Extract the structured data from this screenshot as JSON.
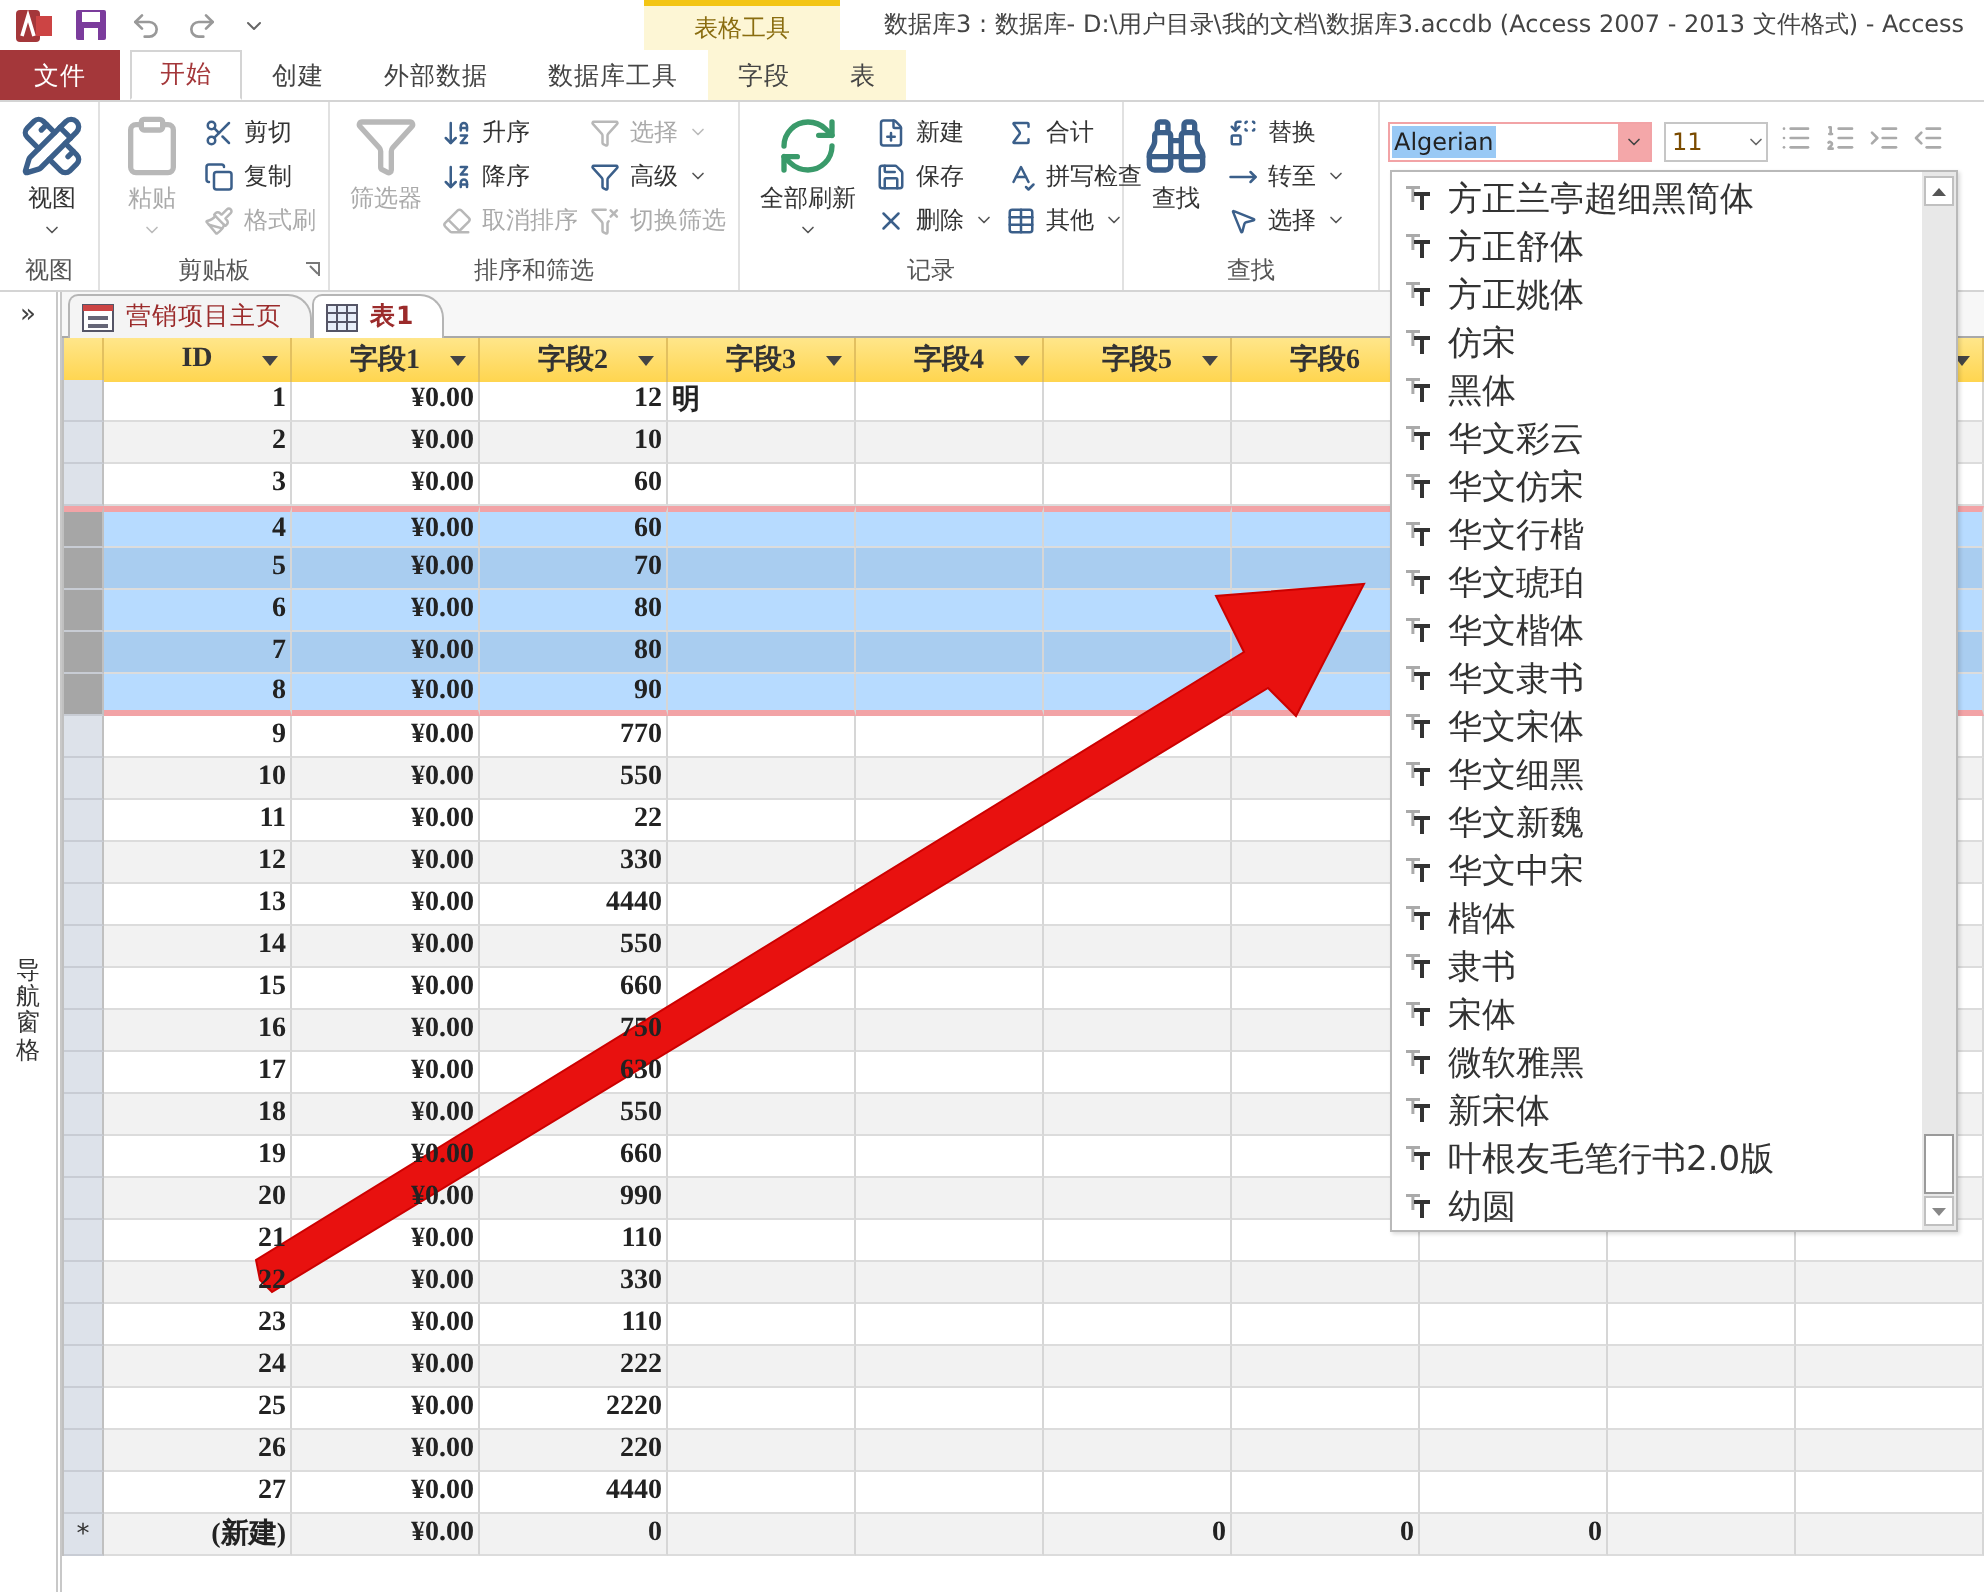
{
  "window": {
    "title": "数据库3 : 数据库- D:\\用户目录\\我的文档\\数据库3.accdb (Access 2007 - 2013 文件格式) - Access",
    "context_label": "表格工具"
  },
  "tabs": [
    {
      "label": "文件",
      "kind": "file",
      "selected": false
    },
    {
      "label": "开始",
      "kind": "normal",
      "selected": true
    },
    {
      "label": "创建",
      "kind": "normal",
      "selected": false
    },
    {
      "label": "外部数据",
      "kind": "normal",
      "selected": false
    },
    {
      "label": "数据库工具",
      "kind": "normal",
      "selected": false
    },
    {
      "label": "字段",
      "kind": "context",
      "selected": false
    },
    {
      "label": "表",
      "kind": "context",
      "selected": false
    }
  ],
  "ribbon": [
    {
      "label": "视图",
      "items": [
        {
          "label": "视图",
          "kind": "large",
          "disabled": false,
          "dropdown": true
        }
      ]
    },
    {
      "label": "剪贴板",
      "launcher": true,
      "items": [
        {
          "label": "粘贴",
          "kind": "large",
          "disabled": true,
          "dropdown": true
        },
        {
          "label": "剪切",
          "kind": "small",
          "disabled": false,
          "dropdown": false
        },
        {
          "label": "复制",
          "kind": "small",
          "disabled": false,
          "dropdown": false
        },
        {
          "label": "格式刷",
          "kind": "small",
          "disabled": true,
          "dropdown": false
        }
      ]
    },
    {
      "label": "排序和筛选",
      "items": [
        {
          "label": "筛选器",
          "kind": "large",
          "disabled": true,
          "dropdown": false
        },
        {
          "label": "升序",
          "kind": "small",
          "disabled": false,
          "dropdown": false
        },
        {
          "label": "降序",
          "kind": "small",
          "disabled": false,
          "dropdown": false
        },
        {
          "label": "取消排序",
          "kind": "small",
          "disabled": true,
          "dropdown": false
        },
        {
          "label": "选择",
          "kind": "small",
          "disabled": true,
          "dropdown": true
        },
        {
          "label": "高级",
          "kind": "small",
          "disabled": false,
          "dropdown": true
        },
        {
          "label": "切换筛选",
          "kind": "small",
          "disabled": true,
          "dropdown": false
        }
      ]
    },
    {
      "label": "记录",
      "items": [
        {
          "label": "全部刷新",
          "kind": "large",
          "disabled": false,
          "dropdown": true
        },
        {
          "label": "新建",
          "kind": "small",
          "disabled": false,
          "dropdown": false
        },
        {
          "label": "保存",
          "kind": "small",
          "disabled": false,
          "dropdown": false
        },
        {
          "label": "删除",
          "kind": "small",
          "disabled": false,
          "dropdown": true
        },
        {
          "label": "合计",
          "kind": "small",
          "disabled": false,
          "dropdown": false
        },
        {
          "label": "拼写检查",
          "kind": "small",
          "disabled": false,
          "dropdown": false
        },
        {
          "label": "其他",
          "kind": "small",
          "disabled": false,
          "dropdown": true
        }
      ]
    },
    {
      "label": "查找",
      "items": [
        {
          "label": "查找",
          "kind": "large",
          "disabled": false,
          "dropdown": false
        },
        {
          "label": "替换",
          "kind": "small",
          "disabled": false,
          "dropdown": false
        },
        {
          "label": "转至",
          "kind": "small",
          "disabled": false,
          "dropdown": true
        },
        {
          "label": "选择",
          "kind": "small",
          "disabled": false,
          "dropdown": true
        }
      ]
    }
  ],
  "font_box": {
    "value": "Algerian",
    "size": "11"
  },
  "font_list": [
    "方正兰亭超细黑简体",
    "方正舒体",
    "方正姚体",
    "仿宋",
    "黑体",
    "华文彩云",
    "华文仿宋",
    "华文行楷",
    "华文琥珀",
    "华文楷体",
    "华文隶书",
    "华文宋体",
    "华文细黑",
    "华文新魏",
    "华文中宋",
    "楷体",
    "隶书",
    "宋体",
    "微软雅黑",
    "新宋体",
    "叶根友毛笔行书2.0版",
    "幼圆"
  ],
  "nav_pane": {
    "label": "导航窗格",
    "toggle": "»"
  },
  "doc_tabs": [
    {
      "label": "营销项目主页",
      "kind": "form",
      "selected": false
    },
    {
      "label": "表1",
      "kind": "table",
      "selected": true
    }
  ],
  "table": {
    "columns": [
      "ID",
      "字段1",
      "字段2",
      "字段3",
      "字段4",
      "字段5",
      "字段6"
    ],
    "rows": [
      {
        "selected": false,
        "id": "1",
        "field_1": "¥0.00",
        "field_2": "12",
        "field_3": "明"
      },
      {
        "selected": false,
        "id": "2",
        "field_1": "¥0.00",
        "field_2": "10"
      },
      {
        "selected": false,
        "id": "3",
        "field_1": "¥0.00",
        "field_2": "60"
      },
      {
        "selected": true,
        "id": "4",
        "field_1": "¥0.00",
        "field_2": "60"
      },
      {
        "selected": true,
        "id": "5",
        "field_1": "¥0.00",
        "field_2": "70"
      },
      {
        "selected": true,
        "id": "6",
        "field_1": "¥0.00",
        "field_2": "80"
      },
      {
        "selected": true,
        "id": "7",
        "field_1": "¥0.00",
        "field_2": "80"
      },
      {
        "selected": true,
        "id": "8",
        "field_1": "¥0.00",
        "field_2": "90"
      },
      {
        "selected": false,
        "id": "9",
        "field_1": "¥0.00",
        "field_2": "770"
      },
      {
        "selected": false,
        "id": "10",
        "field_1": "¥0.00",
        "field_2": "550"
      },
      {
        "selected": false,
        "id": "11",
        "field_1": "¥0.00",
        "field_2": "22"
      },
      {
        "selected": false,
        "id": "12",
        "field_1": "¥0.00",
        "field_2": "330"
      },
      {
        "selected": false,
        "id": "13",
        "field_1": "¥0.00",
        "field_2": "4440"
      },
      {
        "selected": false,
        "id": "14",
        "field_1": "¥0.00",
        "field_2": "550"
      },
      {
        "selected": false,
        "id": "15",
        "field_1": "¥0.00",
        "field_2": "660"
      },
      {
        "selected": false,
        "id": "16",
        "field_1": "¥0.00",
        "field_2": "750"
      },
      {
        "selected": false,
        "id": "17",
        "field_1": "¥0.00",
        "field_2": "630"
      },
      {
        "selected": false,
        "id": "18",
        "field_1": "¥0.00",
        "field_2": "550"
      },
      {
        "selected": false,
        "id": "19",
        "field_1": "¥0.00",
        "field_2": "660"
      },
      {
        "selected": false,
        "id": "20",
        "field_1": "¥0.00",
        "field_2": "990"
      },
      {
        "selected": false,
        "id": "21",
        "field_1": "¥0.00",
        "field_2": "110"
      },
      {
        "selected": false,
        "id": "22",
        "field_1": "¥0.00",
        "field_2": "330"
      },
      {
        "selected": false,
        "id": "23",
        "field_1": "¥0.00",
        "field_2": "110"
      },
      {
        "selected": false,
        "id": "24",
        "field_1": "¥0.00",
        "field_2": "222"
      },
      {
        "selected": false,
        "id": "25",
        "field_1": "¥0.00",
        "field_2": "2220"
      },
      {
        "selected": false,
        "id": "26",
        "field_1": "¥0.00",
        "field_2": "220"
      },
      {
        "selected": false,
        "id": "27",
        "field_1": "¥0.00",
        "field_2": "4440"
      },
      {
        "selected": false,
        "kind": "new",
        "marker": "*",
        "id": "(新建)",
        "field_1": "¥0.00",
        "field_2": "0",
        "field_5": "0",
        "field_6": "0",
        "column_7": "0"
      }
    ]
  }
}
